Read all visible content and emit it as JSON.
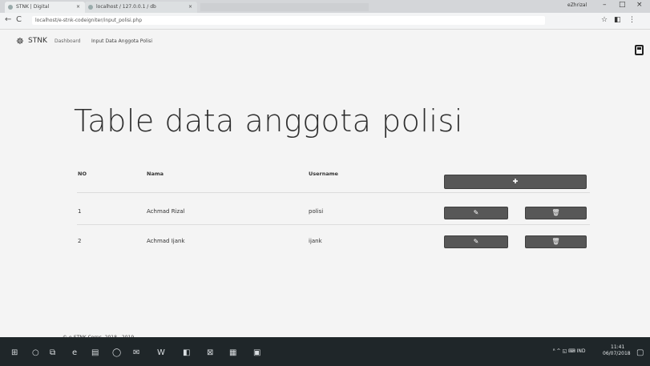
{
  "browser": {
    "tabs": [
      {
        "title": "STNK | Digital"
      },
      {
        "title": "localhost / 127.0.0.1 / db"
      }
    ],
    "profile": "eZhrizal",
    "window_controls": {
      "minimize": "–",
      "maximize": "□",
      "close": "×"
    },
    "nav": {
      "back": "←",
      "forward": "→",
      "reload": "C"
    },
    "url": "localhost/e-stnk-codeigniter/input_polisi.php"
  },
  "app": {
    "brand_icon": "☸",
    "brand": "STNK",
    "breadcrumb": [
      "Dashboard",
      "Input Data Anggota Polisi"
    ]
  },
  "page": {
    "title": "Table data anggota polisi",
    "table": {
      "headers": [
        "NO",
        "Nama",
        "Username"
      ],
      "add_button": "✚",
      "rows": [
        {
          "no": "1",
          "nama": "Achmad Rizal",
          "username": "polisi",
          "edit": "✎",
          "delete": "🗑"
        },
        {
          "no": "2",
          "nama": "Achmad Ijank",
          "username": "ijank",
          "edit": "✎",
          "delete": "🗑"
        }
      ]
    },
    "footer": "© e-STNK Corps. 2018 - 2019"
  },
  "taskbar": {
    "apps": [
      "⊞",
      "○",
      "⧉",
      "e",
      "▤",
      "◯",
      "✉",
      "W",
      "◧",
      "⊠",
      "▦",
      "▣"
    ],
    "tray": "ᴿ  ^  ◱  ⌨  IND",
    "time": "11:41",
    "date": "06/07/2018",
    "notification": "▢"
  },
  "colors": {
    "button": "#575757",
    "taskbar": "#1f2629",
    "page_bg": "#f4f4f4"
  }
}
